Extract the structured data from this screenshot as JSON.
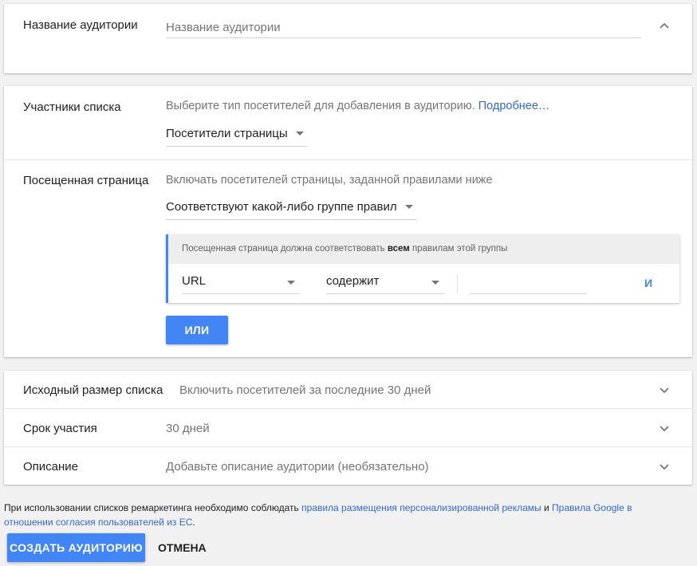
{
  "name_card": {
    "label": "Название аудитории",
    "placeholder": "Название аудитории"
  },
  "members": {
    "label": "Участники списка",
    "hint": "Выберите тип посетителей для добавления в аудиторию.",
    "learn_more": "Подробнее…",
    "type_value": "Посетители страницы"
  },
  "visited": {
    "label": "Посещенная страница",
    "hint": "Включать посетителей страницы, заданной правилами ниже",
    "match_value": "Соответствуют какой-либо группе правил",
    "rule_group": {
      "header_before": "Посещенная страница должна соответствовать ",
      "header_bold": "всем",
      "header_after": " правилам этой группы",
      "field_value": "URL",
      "operator_value": "содержит",
      "value_input": "",
      "and_label": "И"
    },
    "or_button": "ИЛИ"
  },
  "settings": {
    "initial_size": {
      "label": "Исходный размер списка",
      "value": "Включить посетителей за последние 30 дней"
    },
    "duration": {
      "label": "Срок участия",
      "value": "30 дней"
    },
    "description": {
      "label": "Описание",
      "value": "Добавьте описание аудитории (необязательно)"
    }
  },
  "footer": {
    "text_before": "При использовании списков ремаркетинга необходимо соблюдать ",
    "link1": "правила размещения персонализированной рекламы",
    "text_middle": " и ",
    "link2": "Правила Google в отношении согласия пользователей из ЕС",
    "text_after": ".",
    "create_button": "СОЗДАТЬ АУДИТОРИЮ",
    "cancel_button": "ОТМЕНА"
  },
  "colors": {
    "accent": "#4285f4",
    "link": "#3367d6",
    "rule_group_bar": "#4285f4"
  }
}
